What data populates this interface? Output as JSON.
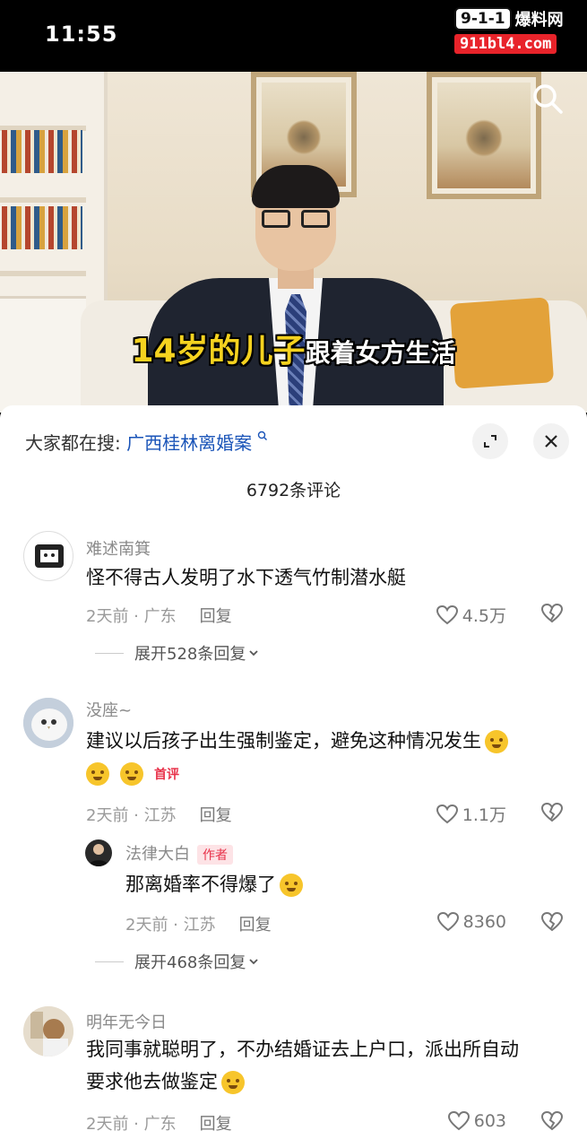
{
  "status_bar": {
    "time": "11:55"
  },
  "watermark": {
    "logo": "9-1-1",
    "name": "爆料网",
    "url": "911bl4.com"
  },
  "video": {
    "caption_highlight": "14岁的儿子",
    "caption_rest": "跟着女方生活"
  },
  "comments_panel": {
    "hot_search_prefix": "大家都在搜:",
    "hot_search_term": "广西桂林离婚案",
    "count_label": "6792条评论"
  },
  "comments": [
    {
      "user": "难述南箕",
      "text": "怪不得古人发明了水下透气竹制潜水艇",
      "meta": "2天前 · 广东",
      "reply": "回复",
      "likes": "4.5万",
      "expand": "展开528条回复"
    },
    {
      "user": "没座~",
      "text": "建议以后孩子出生强制鉴定，避免这种情况发生",
      "badge": "首评",
      "meta": "2天前 · 江苏",
      "reply": "回复",
      "likes": "1.1万"
    },
    {
      "user": "法律大白",
      "badge": "作者",
      "text": "那离婚率不得爆了",
      "meta": "2天前 · 江苏",
      "reply": "回复",
      "likes": "8360",
      "expand": "展开468条回复"
    },
    {
      "user": "明年无今日",
      "text_line1": "我同事就聪明了，不办结婚证去上户口，派出所自动",
      "text_line2": "要求他去做鉴定",
      "meta": "2天前 · 广东",
      "reply": "回复",
      "likes": "603"
    }
  ]
}
